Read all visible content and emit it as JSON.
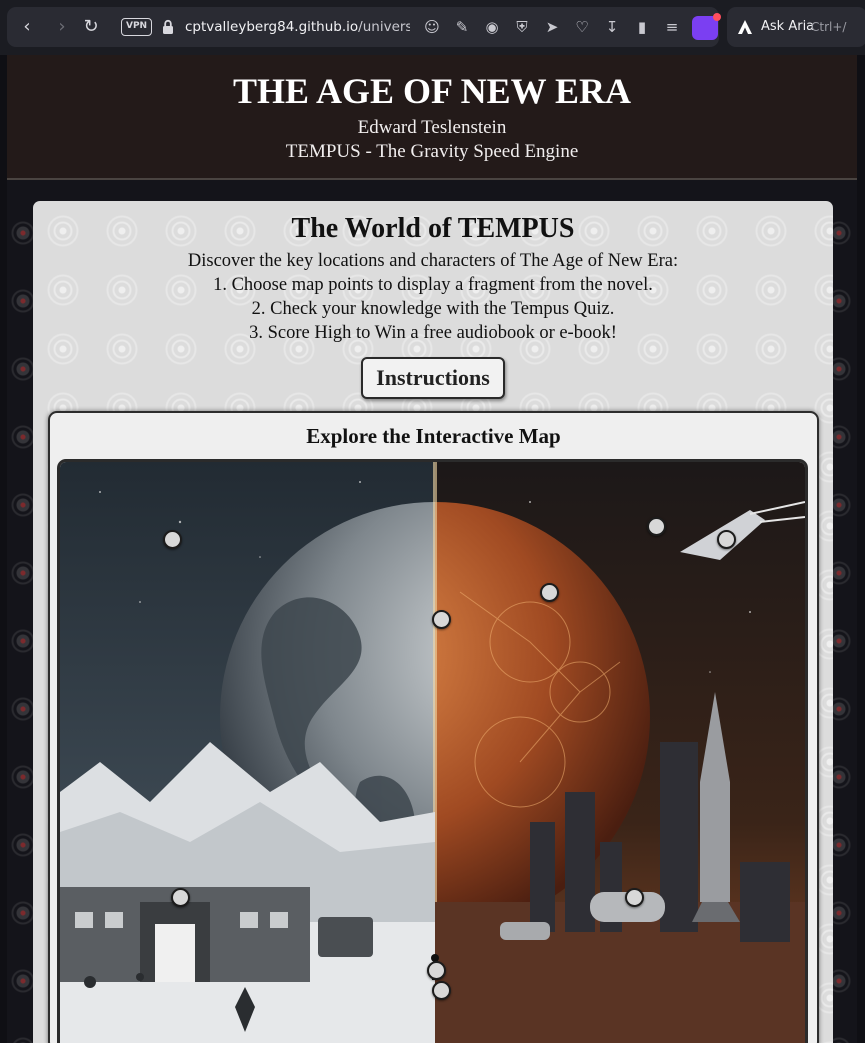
{
  "browser": {
    "nav": {
      "back_icon": "arrow-left-icon",
      "forward_icon": "arrow-right-icon",
      "reload_icon": "reload-icon"
    },
    "vpn_label": "VPN",
    "url_host": "cptvalleyberg84.github.io",
    "url_path": "/universe-of-",
    "toolbar_icons": [
      "emoji-icon",
      "edit-icon",
      "camera-icon",
      "shield-icon",
      "send-icon",
      "heart-icon",
      "download-icon",
      "battery-icon",
      "menu-icon"
    ],
    "aria": {
      "label": "Ask Aria",
      "shortcut": "Ctrl+/"
    },
    "accent": "#7b3ff2"
  },
  "site": {
    "title": "THE AGE OF NEW ERA",
    "author": "Edward Teslenstein",
    "subtitle": "TEMPUS - The Gravity Speed Engine"
  },
  "world": {
    "title": "The World of TEMPUS",
    "intro": [
      "Discover the key locations and characters of The Age of New Era:",
      "1. Choose map points to display a fragment from the novel.",
      "2. Check your knowledge with the Tempus Quiz.",
      "3. Score High to Win a free audiobook or e-book!"
    ],
    "instructions_label": "Instructions"
  },
  "map": {
    "title": "Explore the Interactive Map",
    "colors": {
      "left_sky": "#2f3a44",
      "right_sky": "#2a1a14",
      "planet_left": "#8c949a",
      "planet_right": "#b2532a"
    }
  }
}
